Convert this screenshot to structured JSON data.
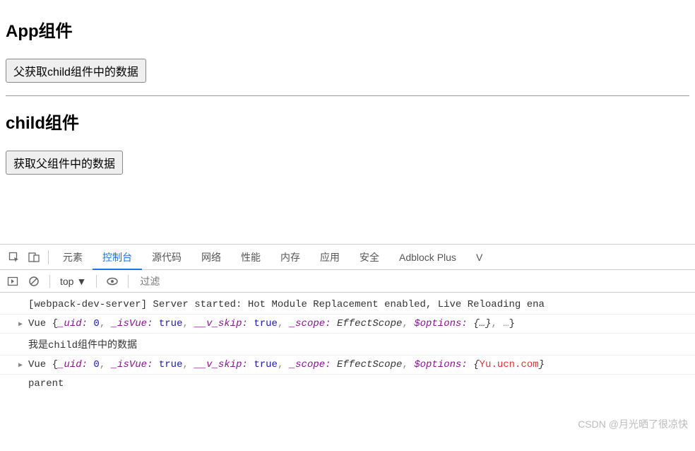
{
  "page": {
    "app_heading": "App组件",
    "app_button": "父获取child组件中的数据",
    "child_heading": "child组件",
    "child_button": "获取父组件中的数据"
  },
  "devtools": {
    "tabs": {
      "elements": "元素",
      "console": "控制台",
      "sources": "源代码",
      "network": "网络",
      "performance": "性能",
      "memory": "内存",
      "application": "应用",
      "security": "安全",
      "adblock": "Adblock Plus",
      "vue_partial": "V"
    },
    "toolbar": {
      "context": "top",
      "filter_placeholder": "过滤"
    },
    "console_lines": {
      "line1": "[webpack-dev-server] Server started: Hot Module Replacement enabled, Live Reloading ena",
      "line2_parts": {
        "cls": "Vue ",
        "k_uid": "_uid:",
        "v_uid": " 0",
        "k_isVue": "_isVue:",
        "v_isVue": " true",
        "k_vskip": "__v_skip:",
        "v_vskip": " true",
        "k_scope": "_scope:",
        "v_scope": " EffectScope",
        "k_opts": "$options:",
        "v_opts": " {…}",
        "tail": ", …"
      },
      "line3": "我是child组件中的数据",
      "line4_parts": {
        "cls": "Vue ",
        "k_uid": "_uid:",
        "v_uid": " 0",
        "k_isVue": "_isVue:",
        "v_isVue": " true",
        "k_vskip": "__v_skip:",
        "v_vskip": " true",
        "k_scope": "_scope:",
        "v_scope": " EffectScope",
        "k_opts": "$options:",
        "v_opts_wm": " {…}",
        "wm1": "Yu.ucn.com"
      },
      "line5": "parent"
    }
  },
  "watermark": "CSDN @月光晒了很凉快"
}
